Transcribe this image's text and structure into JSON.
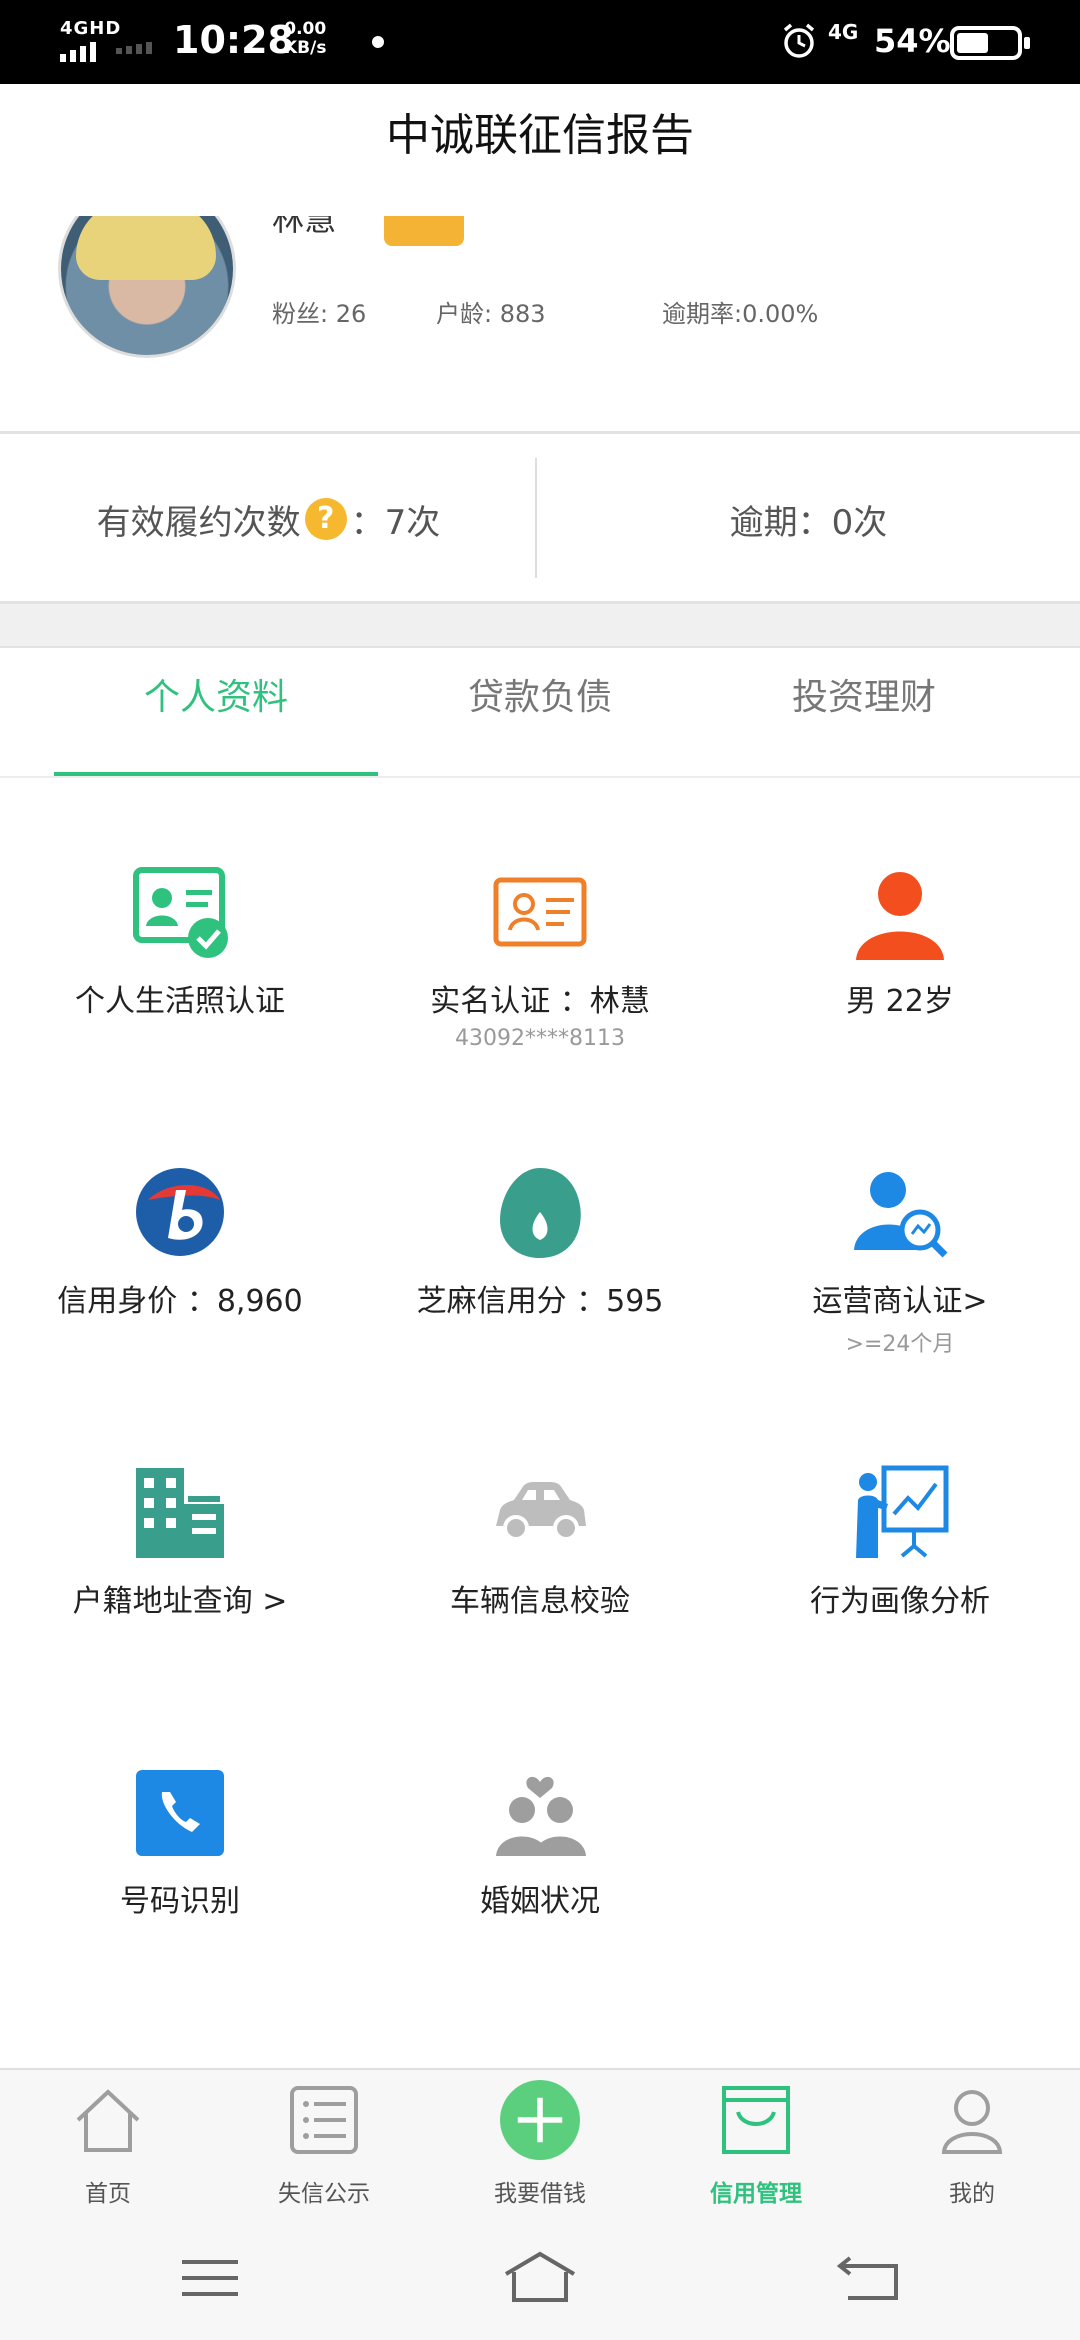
{
  "status_bar": {
    "network": "4GHD",
    "time": "10:28",
    "speed_value": "0.00",
    "speed_unit": "KB/s",
    "network2": "4G",
    "battery": "54%",
    "battery_level": 0.54
  },
  "header": {
    "title": "中诚联征信报告"
  },
  "profile": {
    "name": "林慧",
    "fans": "粉丝: 26",
    "account_age": "户龄: 883",
    "overdue_rate": "逾期率:0.00%"
  },
  "summary": {
    "fulfill_label": "有效履约次数",
    "fulfill_value": "：7次",
    "help_glyph": "?",
    "overdue": "逾期：0次"
  },
  "tabs": [
    {
      "label": "个人资料",
      "active": true
    },
    {
      "label": "贷款负债",
      "active": false
    },
    {
      "label": "投资理财",
      "active": false
    }
  ],
  "grid": [
    {
      "label": "个人生活照认证",
      "icon": "id-card-check-icon"
    },
    {
      "label": "实名认证 ：林慧",
      "sub": "43092****8113",
      "icon": "id-card-icon"
    },
    {
      "label": "男  22岁",
      "icon": "person-icon"
    },
    {
      "label": "信用身价 ：8,960",
      "icon": "credit-value-logo-icon"
    },
    {
      "label": "芝麻信用分 ：595",
      "icon": "sesame-logo-icon"
    },
    {
      "label": "运营商认证>",
      "sub": ">=24个月",
      "icon": "operator-search-icon"
    },
    {
      "label": "户籍地址查询 >",
      "icon": "building-icon"
    },
    {
      "label": "车辆信息校验",
      "icon": "car-icon"
    },
    {
      "label": "行为画像分析",
      "icon": "presentation-icon"
    },
    {
      "label": "号码识别",
      "icon": "phone-book-icon"
    },
    {
      "label": "婚姻状况",
      "icon": "couple-icon"
    }
  ],
  "bottom_nav": [
    {
      "label": "首页",
      "icon": "home-icon"
    },
    {
      "label": "失信公示",
      "icon": "list-icon"
    },
    {
      "label": "我要借钱",
      "icon": "plus-circle-icon"
    },
    {
      "label": "信用管理",
      "icon": "bag-icon",
      "active": true
    },
    {
      "label": "我的",
      "icon": "user-icon"
    }
  ],
  "colors": {
    "accent": "#2ec27e",
    "badge": "#f5b335",
    "orange": "#f07f2a",
    "blue": "#1e88e5",
    "teal": "#3a9e8c"
  }
}
